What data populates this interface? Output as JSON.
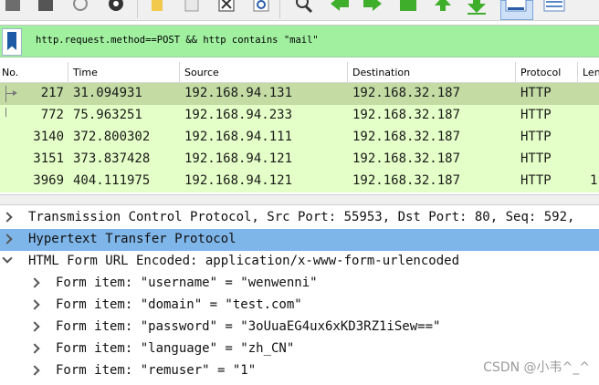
{
  "toolbar": {
    "icons": [
      "open-icon",
      "save-icon",
      "reload-icon",
      "settings-icon",
      "folder-icon",
      "file-icon",
      "close-file-icon",
      "reload-file-icon",
      "find-icon",
      "back-icon",
      "forward-icon",
      "goto-icon",
      "first-packet-icon",
      "last-packet-icon",
      "autoscroll-icon",
      "colorize-icon"
    ]
  },
  "filter": {
    "value": "http.request.method==POST && http contains \"mail\""
  },
  "columns": [
    "No.",
    "Time",
    "Source",
    "Destination",
    "Protocol",
    "Len"
  ],
  "packets": [
    {
      "no": "217",
      "time": "31.094931",
      "source": "192.168.94.131",
      "destination": "192.168.32.187",
      "protocol": "HTTP",
      "length": ""
    },
    {
      "no": "772",
      "time": "75.963251",
      "source": "192.168.94.233",
      "destination": "192.168.32.187",
      "protocol": "HTTP",
      "length": ""
    },
    {
      "no": "3140",
      "time": "372.800302",
      "source": "192.168.94.111",
      "destination": "192.168.32.187",
      "protocol": "HTTP",
      "length": ""
    },
    {
      "no": "3151",
      "time": "373.837428",
      "source": "192.168.94.121",
      "destination": "192.168.32.187",
      "protocol": "HTTP",
      "length": ""
    },
    {
      "no": "3969",
      "time": "404.111975",
      "source": "192.168.94.121",
      "destination": "192.168.32.187",
      "protocol": "HTTP",
      "length": "1"
    }
  ],
  "details": {
    "tcp": "Transmission Control Protocol, Src Port: 55953, Dst Port: 80, Seq: 592,",
    "http": "Hypertext Transfer Protocol",
    "form": "HTML Form URL Encoded: application/x-www-form-urlencoded",
    "items": [
      "Form item: \"username\" = \"wenwenni\"",
      "Form item: \"domain\" = \"test.com\"",
      "Form item: \"password\" = \"3oUuaEG4ux6xKD3RZ1iSew==\"",
      "Form item: \"language\" = \"zh_CN\"",
      "Form item: \"remuser\" = \"1\""
    ]
  },
  "watermark": "CSDN @小韦^_^",
  "colors": {
    "filter_bg": "#a0f0a0",
    "row_bg": "#e4ffc7",
    "row_selected": "#c4dca4",
    "detail_highlight": "#7fb6ea"
  }
}
